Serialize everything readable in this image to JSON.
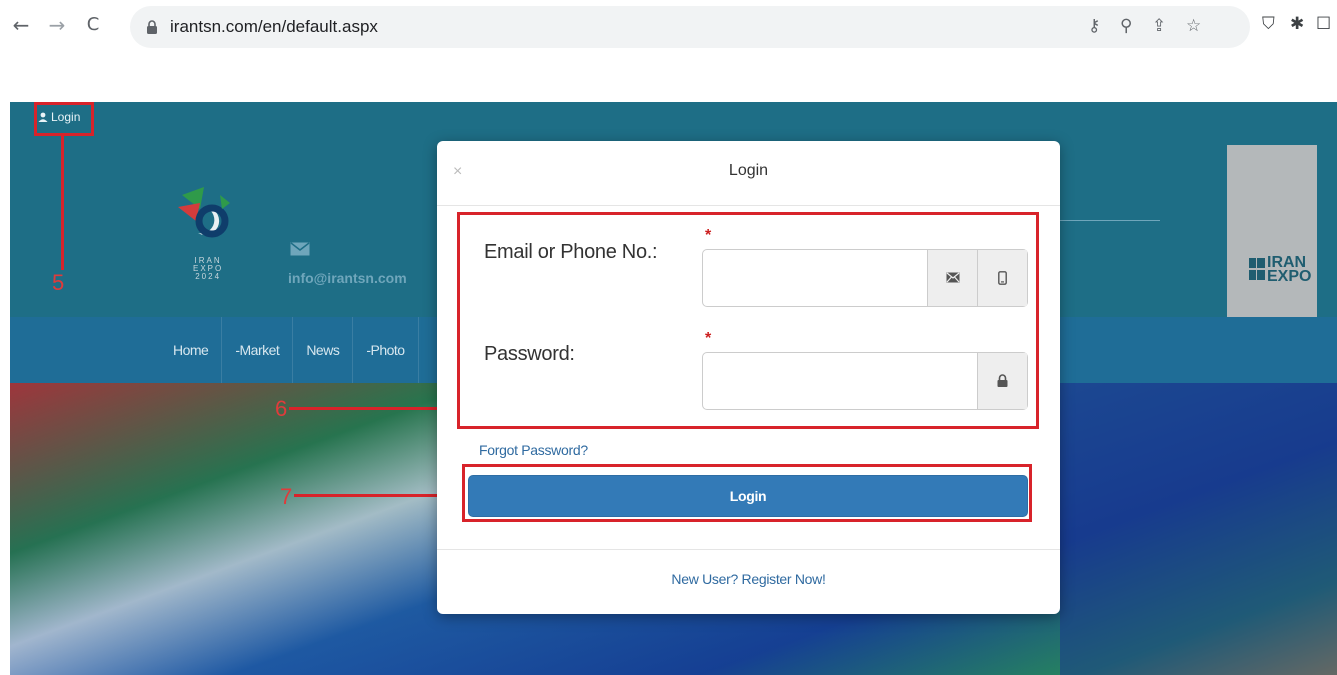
{
  "browser": {
    "back_icon": "back-arrow-icon",
    "forward_icon": "forward-arrow-icon",
    "reload_icon": "reload-icon",
    "url": "irantsn.com/en/default.aspx",
    "omnibox_icons": [
      "key-icon",
      "zoom-icon",
      "share-icon",
      "star-icon"
    ],
    "extension_icons": [
      "shield-extension-icon",
      "puzzle-extension-icon",
      "window-icon"
    ]
  },
  "site": {
    "login_link": "Login",
    "logo_text": [
      "IRAN",
      "EXPO",
      "2024"
    ],
    "email": "info@irantsn.com",
    "partner_logo": [
      "IRAN",
      "EXPO"
    ],
    "nav": [
      "Home",
      "-Market",
      "News",
      "-Photo"
    ],
    "colors": {
      "header": "#1e6e86",
      "navbar": "#1f6d97",
      "annotation": "#d8232a"
    }
  },
  "annotations": {
    "five": "5",
    "six": "6",
    "seven": "7"
  },
  "modal": {
    "close": "×",
    "title": "Login",
    "email_label": "Email or Phone No.:",
    "required_mark": "*",
    "email_value": "",
    "password_label": "Password:",
    "password_value": "",
    "forgot": "Forgot Password?",
    "login_button": "Login",
    "register": "New User? Register Now!",
    "button_color": "#337ab7"
  }
}
